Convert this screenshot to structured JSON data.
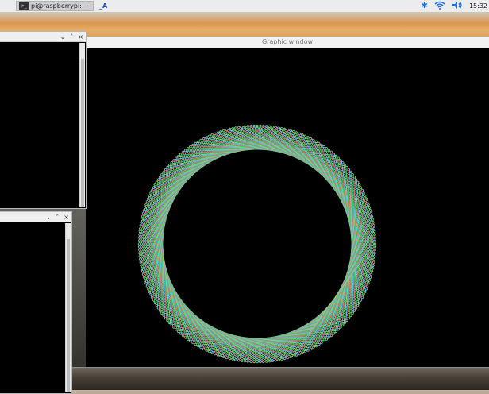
{
  "taskbar": {
    "terminal_task_label": "pi@raspberrypi: ~",
    "second_task_label": "_A",
    "icons": [
      "terminal-icon",
      "bluetooth-icon",
      "wifi-icon",
      "volume-icon"
    ],
    "clock": "15:32"
  },
  "graphic_window": {
    "title": "Graphic window",
    "background": "#000000",
    "line_colors": [
      "#2ecc71",
      "#e57373",
      "#4fc3f7",
      "#9ccc65"
    ]
  },
  "terminal_windows": [
    {
      "controls": [
        "⌄",
        "˄",
        "×"
      ]
    },
    {
      "controls": [
        "⌄",
        "˄",
        "×"
      ]
    }
  ]
}
